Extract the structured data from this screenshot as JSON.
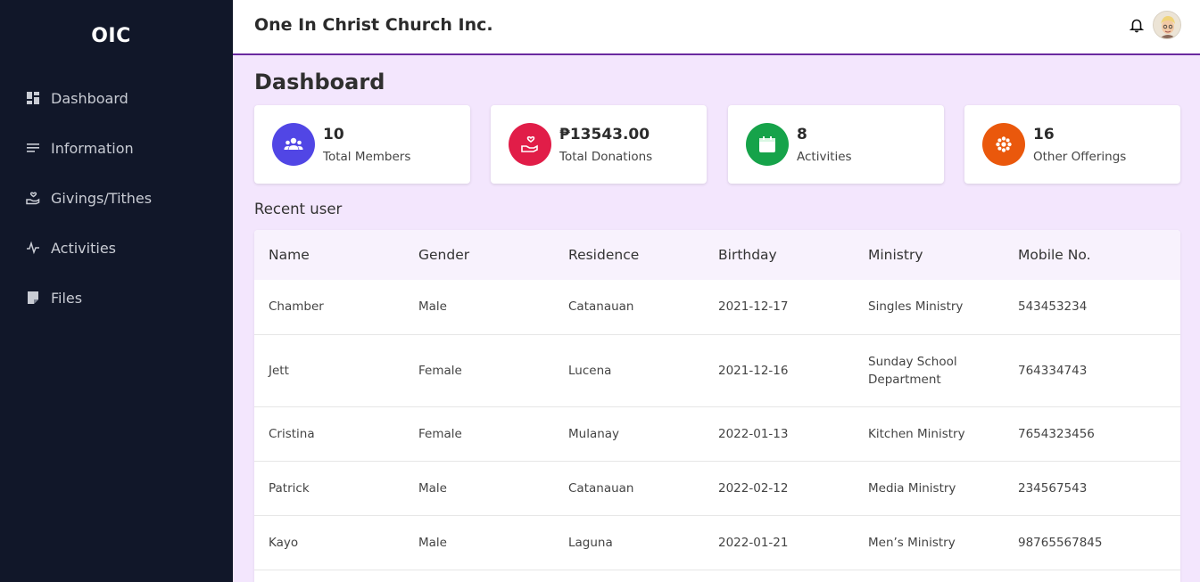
{
  "sidebar": {
    "brand": "OIC",
    "items": [
      {
        "label": "Dashboard",
        "icon": "dashboard-icon"
      },
      {
        "label": "Information",
        "icon": "notes-icon"
      },
      {
        "label": "Givings/Tithes",
        "icon": "giving-hand-icon"
      },
      {
        "label": "Activities",
        "icon": "pulse-icon"
      },
      {
        "label": "Files",
        "icon": "file-icon"
      }
    ]
  },
  "header": {
    "title": "One In Christ Church Inc."
  },
  "main": {
    "title": "Dashboard",
    "cards": [
      {
        "value": "10",
        "label": "Total Members",
        "icon": "members-icon",
        "color": "#5146e5"
      },
      {
        "value": "₱13543.00",
        "label": "Total Donations",
        "icon": "donation-icon",
        "color": "#e11d48"
      },
      {
        "value": "8",
        "label": "Activities",
        "icon": "calendar-icon",
        "color": "#16a34a"
      },
      {
        "value": "16",
        "label": "Other Offerings",
        "icon": "offering-icon",
        "color": "#ea580c"
      }
    ],
    "recent_title": "Recent user",
    "table": {
      "columns": [
        "Name",
        "Gender",
        "Residence",
        "Birthday",
        "Ministry",
        "Mobile No."
      ],
      "rows": [
        [
          "Chamber",
          "Male",
          "Catanauan",
          "2021-12-17",
          "Singles Ministry",
          "543453234"
        ],
        [
          "Jett",
          "Female",
          "Lucena",
          "2021-12-16",
          "Sunday School Department",
          "764334743"
        ],
        [
          "Cristina",
          "Female",
          "Mulanay",
          "2022-01-13",
          "Kitchen Ministry",
          "7654323456"
        ],
        [
          "Patrick",
          "Male",
          "Catanauan",
          "2022-02-12",
          "Media Ministry",
          "234567543"
        ],
        [
          "Kayo",
          "Male",
          "Laguna",
          "2022-01-21",
          "Men’s Ministry",
          "98765567845"
        ]
      ]
    }
  }
}
